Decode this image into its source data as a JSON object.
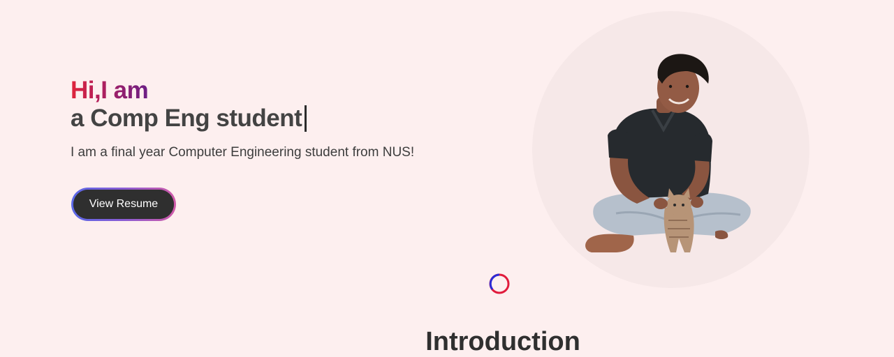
{
  "hero": {
    "greeting": "Hi,I am",
    "typed_text": "a Comp Eng student",
    "subtitle": "I am a final year Computer Engineering student from NUS!",
    "resume_button_label": "View Resume",
    "photo_alt": "Smiling person sitting cross-legged holding a cat"
  },
  "loading_indicator": {
    "icon": "spinner-icon"
  },
  "next_section": {
    "heading": "Introduction"
  },
  "colors": {
    "background": "#fdefef",
    "greeting_gradient_start": "#e0243a",
    "greeting_gradient_end": "#6b1f86",
    "heading_text": "#434343",
    "button_bg": "#2f2f2f",
    "button_border_gradient_start": "#5a68e6",
    "button_border_gradient_end": "#d05aa8",
    "photo_circle": "#f6e8e8"
  }
}
